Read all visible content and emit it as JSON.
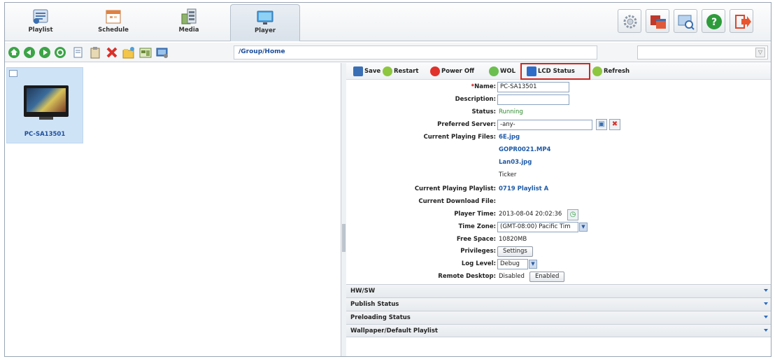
{
  "tabs": [
    {
      "label": "Playlist",
      "icon": "playlist-icon"
    },
    {
      "label": "Schedule",
      "icon": "calendar-icon"
    },
    {
      "label": "Media",
      "icon": "film-icon"
    },
    {
      "label": "Player",
      "icon": "monitor-icon",
      "active": true
    }
  ],
  "top_right_icons": [
    "gear-icon",
    "windows-icon",
    "screen-search-icon",
    "help-icon",
    "logout-icon"
  ],
  "toolbar_icons": [
    "home-icon",
    "back-icon",
    "forward-icon",
    "refresh-icon",
    "copy-icon",
    "paste-icon",
    "delete-icon",
    "new-folder-icon",
    "edit-icon",
    "player-add-icon"
  ],
  "path": "/Group/Home",
  "search": {
    "value": ""
  },
  "player_item": {
    "name": "PC-SA13501"
  },
  "actions": {
    "save": "Save",
    "restart": "Restart",
    "power_off": "Power Off",
    "wol": "WOL",
    "lcd_status": "LCD Status",
    "refresh": "Refresh"
  },
  "fields": {
    "name_label": "Name:",
    "name_req": "*",
    "name_value": "PC-SA13501",
    "description_label": "Description:",
    "description_value": "",
    "status_label": "Status:",
    "status_value": "Running",
    "preferred_server_label": "Preferred Server:",
    "preferred_server_value": "-any-",
    "playing_files_label": "Current Playing Files:",
    "playing_files": [
      "6E.jpg",
      "GOPR0021.MP4",
      "Lan03.jpg",
      "Ticker"
    ],
    "playing_playlist_label": "Current Playing Playlist:",
    "playing_playlist_value": "0719 Playlist A",
    "download_label": "Current Download File:",
    "download_value": "",
    "player_time_label": "Player Time:",
    "player_time_value": "2013-08-04 20:02:36",
    "timezone_label": "Time Zone:",
    "timezone_value": "(GMT-08:00) Pacific Tim",
    "free_space_label": "Free Space:",
    "free_space_value": "10820MB",
    "privileges_label": "Privileges:",
    "privileges_button": "Settings",
    "log_level_label": "Log Level:",
    "log_level_value": "Debug",
    "remote_desktop_label": "Remote Desktop:",
    "remote_desktop_value": "Disabled",
    "remote_desktop_button": "Enabled"
  },
  "sections": [
    "HW/SW",
    "Publish Status",
    "Preloading Status",
    "Wallpaper/Default Playlist"
  ],
  "colors": {
    "highlight": "#d0241f",
    "link": "#1d5aa8",
    "status": "#2f8a2f"
  }
}
